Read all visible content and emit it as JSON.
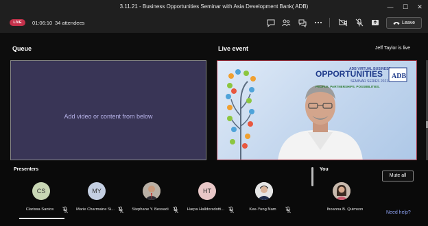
{
  "window": {
    "title": "3.11.21 - Business Opportunities Seminar with Asia Development Bank( ADB)"
  },
  "toolbar": {
    "live_badge": "LIVE",
    "timer": "01:06:10",
    "attendees": "34 attendees",
    "leave_label": "Leave",
    "icons": [
      "chat-icon",
      "people-icon",
      "qa-icon",
      "more-icon",
      "camera-off-icon",
      "mic-off-icon",
      "share-icon"
    ]
  },
  "queue": {
    "title": "Queue",
    "hint": "Add video or content from below"
  },
  "live_event": {
    "title": "Live event",
    "status": "Jeff Taylor is live",
    "slide": {
      "top_line": "ADB VIRTUAL BUSINESS",
      "headline": "OPPORTUNITIES",
      "series": "SEMINAR SERIES 2021",
      "tagline": "PEOPLE. PARTNERSHIPS. POSSIBILITIES.",
      "logo": "ADB"
    }
  },
  "panel": {
    "presenters_label": "Presenters",
    "you_label": "You",
    "mute_all": "Mute all",
    "need_help": "Need help?",
    "presenters": [
      {
        "initials": "CS",
        "name": "Clarissa Santos",
        "color": "#c8d6b4"
      },
      {
        "initials": "MY",
        "name": "Marie Charmaine Si...",
        "color": "#c4cfe2"
      },
      {
        "initials": "",
        "name": "Stephane Y. Bessadi",
        "color": "#8a7a66"
      },
      {
        "initials": "HT",
        "name": "Harpa Halldorsdotti...",
        "color": "#e8c7c7"
      },
      {
        "initials": "",
        "name": "Kee-Yung Nam",
        "color": "#d9d9d9"
      }
    ],
    "you": {
      "name": "Ihoanna B. Quimson",
      "color": "#a88c7a"
    }
  },
  "colors": {
    "live": "#c4314b",
    "queue_bg": "#393556",
    "link": "#8ea2f3"
  }
}
